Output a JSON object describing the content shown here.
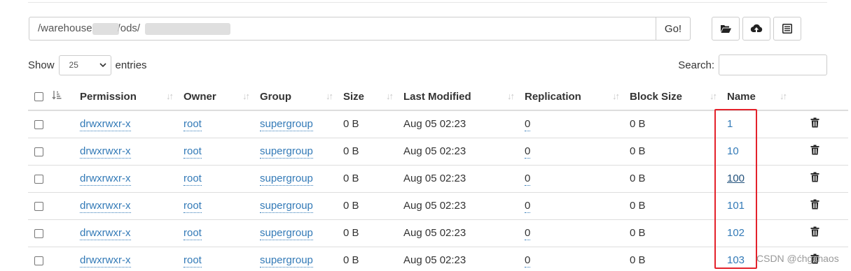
{
  "path": {
    "value_start": "/warehouse",
    "value_mid": "/ods/",
    "go_label": "Go!"
  },
  "toolbar": {
    "icons": [
      "folder-open-icon",
      "cloud-upload-icon",
      "list-alt-icon"
    ]
  },
  "length_menu": {
    "show_label": "Show",
    "selected": "25",
    "entries_label": "entries"
  },
  "search": {
    "label": "Search:",
    "value": ""
  },
  "table": {
    "headers": {
      "permission": "Permission",
      "owner": "Owner",
      "group": "Group",
      "size": "Size",
      "last_modified": "Last Modified",
      "replication": "Replication",
      "block_size": "Block Size",
      "name": "Name"
    },
    "rows": [
      {
        "permission": "drwxrwxr-x",
        "owner": "root",
        "group": "supergroup",
        "size": "0 B",
        "last_modified": "Aug 05 02:23",
        "replication": "0",
        "block_size": "0 B",
        "name": "1"
      },
      {
        "permission": "drwxrwxr-x",
        "owner": "root",
        "group": "supergroup",
        "size": "0 B",
        "last_modified": "Aug 05 02:23",
        "replication": "0",
        "block_size": "0 B",
        "name": "10"
      },
      {
        "permission": "drwxrwxr-x",
        "owner": "root",
        "group": "supergroup",
        "size": "0 B",
        "last_modified": "Aug 05 02:23",
        "replication": "0",
        "block_size": "0 B",
        "name": "100"
      },
      {
        "permission": "drwxrwxr-x",
        "owner": "root",
        "group": "supergroup",
        "size": "0 B",
        "last_modified": "Aug 05 02:23",
        "replication": "0",
        "block_size": "0 B",
        "name": "101"
      },
      {
        "permission": "drwxrwxr-x",
        "owner": "root",
        "group": "supergroup",
        "size": "0 B",
        "last_modified": "Aug 05 02:23",
        "replication": "0",
        "block_size": "0 B",
        "name": "102"
      },
      {
        "permission": "drwxrwxr-x",
        "owner": "root",
        "group": "supergroup",
        "size": "0 B",
        "last_modified": "Aug 05 02:23",
        "replication": "0",
        "block_size": "0 B",
        "name": "103"
      }
    ]
  },
  "watermark": "CSDN @ćhgchaos",
  "colors": {
    "link": "#337ab7",
    "highlight_box": "#e4222b"
  }
}
